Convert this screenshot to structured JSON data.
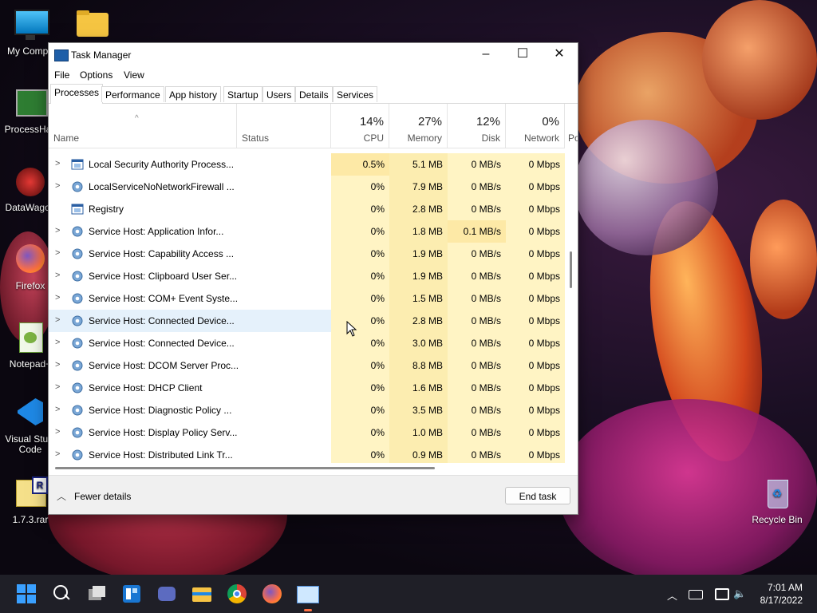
{
  "desktop": {
    "icons": [
      {
        "label": "My Compu"
      },
      {
        "label": ""
      },
      {
        "label": "ProcessHac"
      },
      {
        "label": "DataWagon"
      },
      {
        "label": "Firefox"
      },
      {
        "label": "Notepad+"
      },
      {
        "label": "Visual Studi Code"
      },
      {
        "label": "1.7.3.rar"
      },
      {
        "label": "Recycle Bin"
      }
    ]
  },
  "window": {
    "title": "Task Manager",
    "menu": [
      "File",
      "Options",
      "View"
    ],
    "tabs": [
      "Processes",
      "Performance",
      "App history",
      "Startup",
      "Users",
      "Details",
      "Services"
    ],
    "active_tab": "Processes",
    "columns": {
      "name": "Name",
      "status": "Status",
      "cpu": {
        "pct": "14%",
        "label": "CPU"
      },
      "memory": {
        "pct": "27%",
        "label": "Memory"
      },
      "disk": {
        "pct": "12%",
        "label": "Disk"
      },
      "network": {
        "pct": "0%",
        "label": "Network"
      },
      "power": "Po"
    },
    "rows": [
      {
        "name": "Local Security Authority Process...",
        "cpu": "0.5%",
        "memory": "5.1 MB",
        "disk": "0 MB/s",
        "network": "0 Mbps",
        "expandable": true,
        "icon": "window-icon"
      },
      {
        "name": "LocalServiceNoNetworkFirewall ...",
        "cpu": "0%",
        "memory": "7.9 MB",
        "disk": "0 MB/s",
        "network": "0 Mbps",
        "expandable": true,
        "icon": "gear-icon"
      },
      {
        "name": "Registry",
        "cpu": "0%",
        "memory": "2.8 MB",
        "disk": "0 MB/s",
        "network": "0 Mbps",
        "expandable": false,
        "icon": "window-icon"
      },
      {
        "name": "Service Host: Application Infor...",
        "cpu": "0%",
        "memory": "1.8 MB",
        "disk": "0.1 MB/s",
        "network": "0 Mbps",
        "expandable": true,
        "icon": "gear-icon"
      },
      {
        "name": "Service Host: Capability Access ...",
        "cpu": "0%",
        "memory": "1.9 MB",
        "disk": "0 MB/s",
        "network": "0 Mbps",
        "expandable": true,
        "icon": "gear-icon"
      },
      {
        "name": "Service Host: Clipboard User Ser...",
        "cpu": "0%",
        "memory": "1.9 MB",
        "disk": "0 MB/s",
        "network": "0 Mbps",
        "expandable": true,
        "icon": "gear-icon"
      },
      {
        "name": "Service Host: COM+ Event Syste...",
        "cpu": "0%",
        "memory": "1.5 MB",
        "disk": "0 MB/s",
        "network": "0 Mbps",
        "expandable": true,
        "icon": "gear-icon"
      },
      {
        "name": "Service Host: Connected Device...",
        "cpu": "0%",
        "memory": "2.8 MB",
        "disk": "0 MB/s",
        "network": "0 Mbps",
        "expandable": true,
        "icon": "gear-icon",
        "highlight": true
      },
      {
        "name": "Service Host: Connected Device...",
        "cpu": "0%",
        "memory": "3.0 MB",
        "disk": "0 MB/s",
        "network": "0 Mbps",
        "expandable": true,
        "icon": "gear-icon"
      },
      {
        "name": "Service Host: DCOM Server Proc...",
        "cpu": "0%",
        "memory": "8.8 MB",
        "disk": "0 MB/s",
        "network": "0 Mbps",
        "expandable": true,
        "icon": "gear-icon"
      },
      {
        "name": "Service Host: DHCP Client",
        "cpu": "0%",
        "memory": "1.6 MB",
        "disk": "0 MB/s",
        "network": "0 Mbps",
        "expandable": true,
        "icon": "gear-icon"
      },
      {
        "name": "Service Host: Diagnostic Policy ...",
        "cpu": "0%",
        "memory": "3.5 MB",
        "disk": "0 MB/s",
        "network": "0 Mbps",
        "expandable": true,
        "icon": "gear-icon"
      },
      {
        "name": "Service Host: Display Policy Serv...",
        "cpu": "0%",
        "memory": "1.0 MB",
        "disk": "0 MB/s",
        "network": "0 Mbps",
        "expandable": true,
        "icon": "gear-icon"
      },
      {
        "name": "Service Host: Distributed Link Tr...",
        "cpu": "0%",
        "memory": "0.9 MB",
        "disk": "0 MB/s",
        "network": "0 Mbps",
        "expandable": true,
        "icon": "gear-icon"
      }
    ],
    "footer": {
      "fewer_details": "Fewer details",
      "end_task": "End task"
    }
  },
  "taskbar": {
    "apps": [
      "start-icon",
      "search-icon",
      "task-view-icon",
      "widgets-icon",
      "chat-icon",
      "file-explorer-icon",
      "chrome-icon",
      "firefox-icon",
      "task-manager-icon"
    ],
    "clock": {
      "time": "7:01 AM",
      "date": "8/17/2022"
    }
  },
  "colors": {
    "accent": "#0078d4",
    "heat_light": "#fff4c4",
    "heat_mem": "#fcedb0",
    "taskbar": "#1f1f27"
  }
}
